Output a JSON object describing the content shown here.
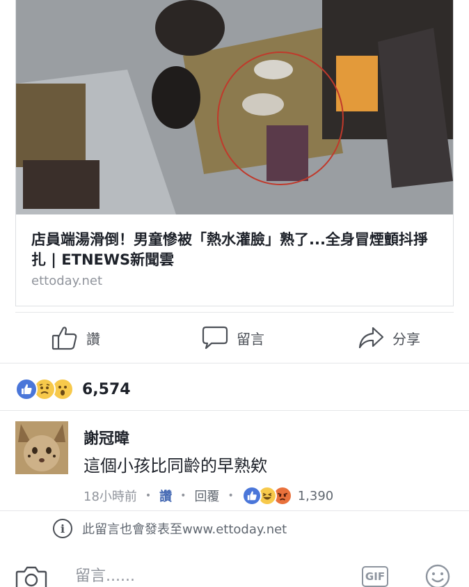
{
  "link_preview": {
    "title": "店員端湯滑倒！男童慘被「熱水灌臉」熟了...全身冒煙顫抖掙扎 | ETNEWS新聞雲",
    "domain": "ettoday.net",
    "image_icon": "photo-thumbnail"
  },
  "actions": {
    "like_label": "讚",
    "comment_label": "留言",
    "share_label": "分享"
  },
  "reactions": {
    "icons": [
      "like-icon",
      "sad-icon",
      "wow-icon"
    ],
    "count": "6,574"
  },
  "comment": {
    "author": "謝冠暐",
    "text": "這個小孩比同齡的早熟欸",
    "time": "18小時前",
    "like_link": "讚",
    "reply_link": "回覆",
    "reaction_icons": [
      "like-icon",
      "haha-icon",
      "angry-icon"
    ],
    "reaction_count": "1,390"
  },
  "notice": {
    "text": "此留言也會發表至www.ettoday.net"
  },
  "composer": {
    "placeholder": "留言......",
    "gif_label": "GIF"
  },
  "colors": {
    "facebook_blue": "#4267b2",
    "like_blue": "#4a76d9",
    "reaction_yellow": "#f7c94b",
    "angry_orange": "#e9713b",
    "meta_gray": "#90949c"
  }
}
